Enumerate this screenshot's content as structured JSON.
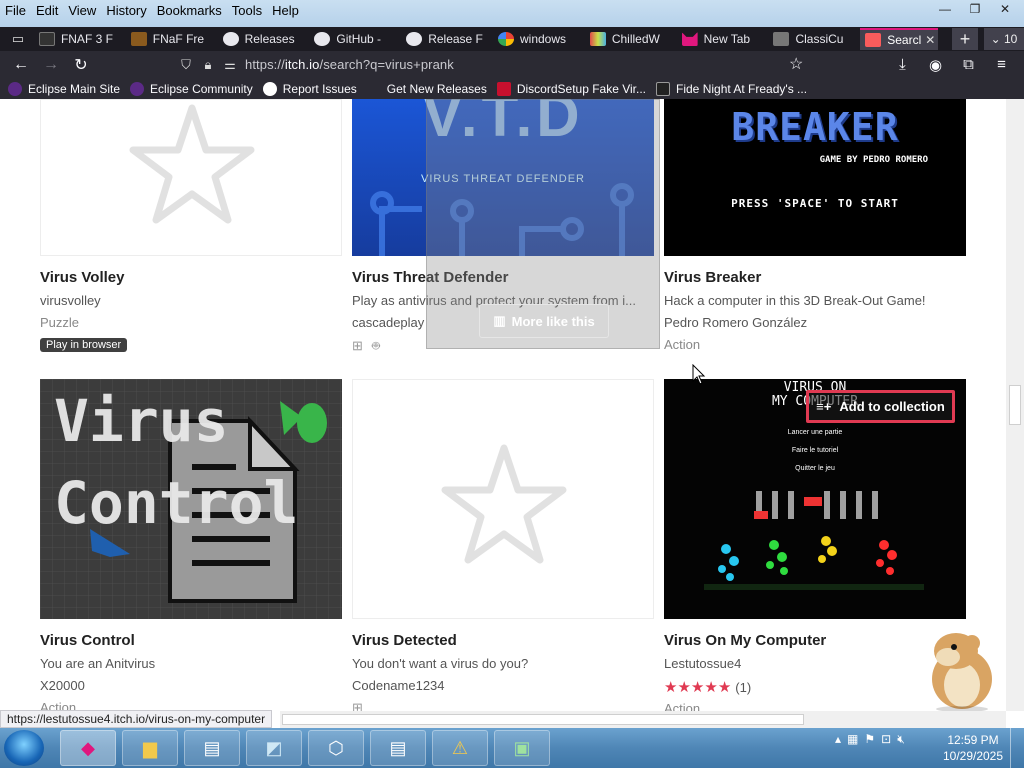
{
  "menu": [
    "File",
    "Edit",
    "View",
    "History",
    "Bookmarks",
    "Tools",
    "Help"
  ],
  "window_controls": {
    "minimize": "—",
    "restore": "❐",
    "close": "✕"
  },
  "tabs": [
    {
      "label": "FNAF 3 F",
      "color": "#333333"
    },
    {
      "label": "FNaF Fre",
      "color": "#8a5a1e"
    },
    {
      "label": "Releases",
      "color": "#e8e8ee"
    },
    {
      "label": "GitHub -",
      "color": "#e8e8ee"
    },
    {
      "label": "Release F",
      "color": "#e8e8ee"
    },
    {
      "label": "windows",
      "color": "#4285f4"
    },
    {
      "label": "ChilledW",
      "color": "#c8e04a"
    },
    {
      "label": "New Tab",
      "color": "#e0177e"
    },
    {
      "label": "ClassiCu",
      "color": "#777777"
    }
  ],
  "active_tab": {
    "label": "Searcl",
    "close": "✕"
  },
  "tab_count": "10",
  "url": {
    "prefix": "https://",
    "host": "itch.io",
    "path": "/search?q=virus+prank"
  },
  "bookmarks": [
    {
      "label": "Eclipse Main Site",
      "color": "#5b2a86"
    },
    {
      "label": "Eclipse Community",
      "color": "#5b2a86"
    },
    {
      "label": "Report Issues",
      "color": "#ffffff"
    },
    {
      "label": "Get New Releases",
      "color": "#2b2a33"
    },
    {
      "label": "DiscordSetup Fake Vir...",
      "color": "#c8102e"
    },
    {
      "label": "Fide Night At Fready's ...",
      "color": "#222222"
    }
  ],
  "games": [
    {
      "title": "Virus Volley",
      "desc": "virusvolley",
      "author": "Puzzle",
      "badge": "Play in browser"
    },
    {
      "title": "Virus Threat Defender",
      "desc": "Play as antivirus and protect your system from i...",
      "author": "cascadeplay",
      "banner": "V.T.D",
      "banner_sub": "VIRUS THREAT DEFENDER"
    },
    {
      "title": "Virus Breaker",
      "desc": "Hack a computer in this 3D Break-Out Game!",
      "author": "Pedro Romero González",
      "genre": "Action",
      "banner": "BREAKER",
      "banner_sub": "GAME BY PEDRO ROMERO",
      "banner_hint": "PRESS 'SPACE' TO START"
    },
    {
      "title": "Virus Control",
      "desc": "You are an Anitvirus",
      "author": "X20000",
      "genre": "Action",
      "banner_line1": "Virus",
      "banner_line2": "Control"
    },
    {
      "title": "Virus Detected",
      "desc": "You don't want a virus do you?",
      "author": "Codename1234"
    },
    {
      "title": "Virus On My Computer",
      "desc": "Lestutossue4",
      "rating_count": "(1)",
      "rating": 5,
      "genre": "Action",
      "banner_line1": "VIRUS ON",
      "banner_line2": "MY COMPUTER",
      "menu_items": [
        "Lancer une partie",
        "Faire le tutoriel",
        "Quitter le jeu"
      ]
    }
  ],
  "overlay": {
    "more_like_this": "More like this",
    "add_to_collection": "Add to collection"
  },
  "status_url": "https://lestutossue4.itch.io/virus-on-my-computer",
  "taskbar": {
    "time": "12:59 PM",
    "date": "10/29/2025"
  },
  "accent": "#e0177e",
  "star_color": "#e03a52"
}
